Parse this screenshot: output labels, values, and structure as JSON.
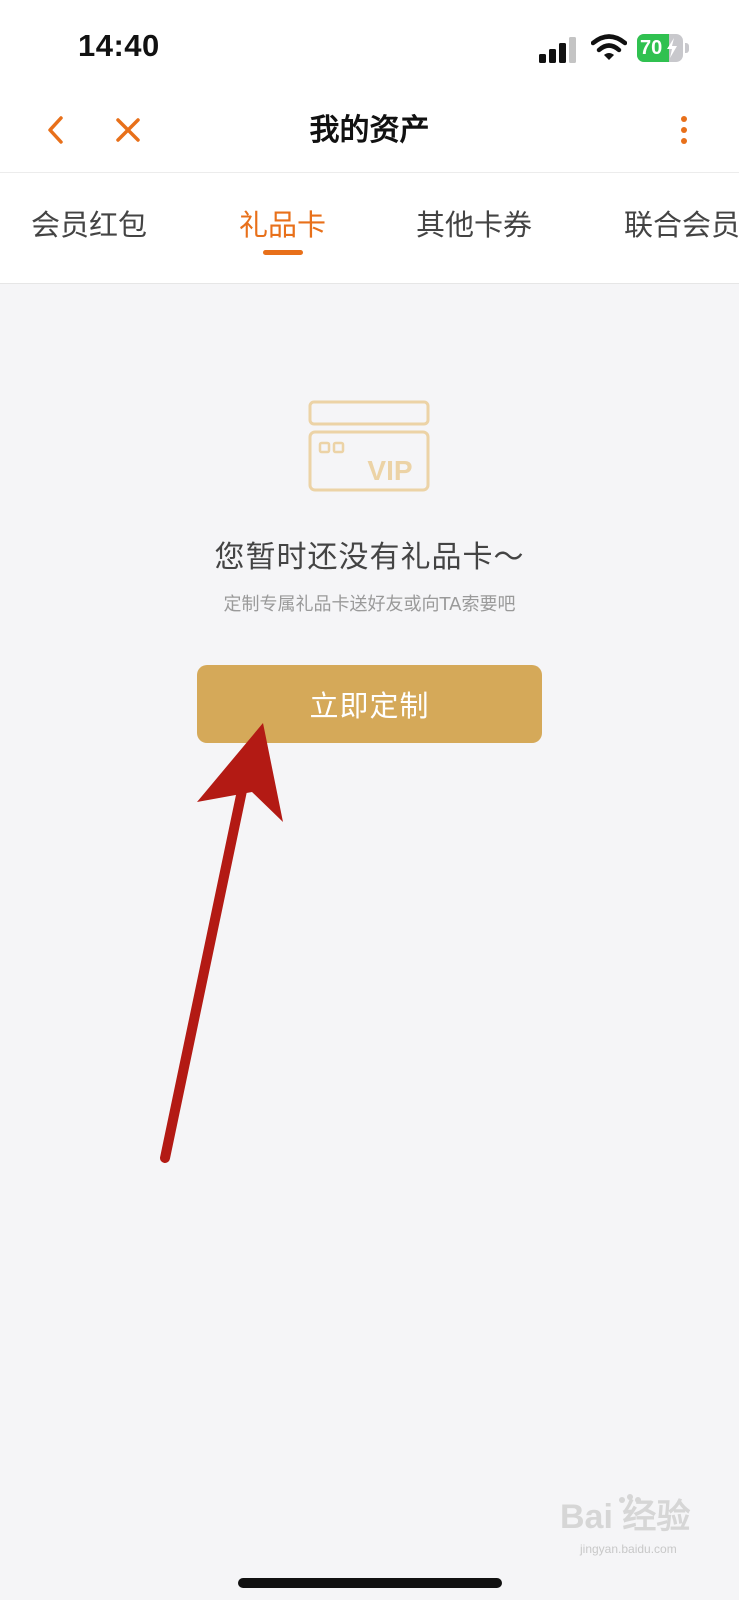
{
  "status_bar": {
    "time": "14:40",
    "battery_level": "70",
    "battery_fraction": 0.7,
    "signal_icon": "signal-bars-icon",
    "wifi_icon": "wifi-icon",
    "charging_icon": "lightning-icon"
  },
  "nav": {
    "title": "我的资产",
    "back_icon": "chevron-left-icon",
    "close_icon": "close-icon",
    "more_icon": "more-vertical-icon",
    "accent_color": "#e8701a"
  },
  "tabs": [
    {
      "label": "会员红包",
      "active": false
    },
    {
      "label": "礼品卡",
      "active": true
    },
    {
      "label": "其他卡券",
      "active": false
    },
    {
      "label": "联合会员",
      "active": false
    }
  ],
  "empty_state": {
    "icon": "vip-card-icon",
    "icon_label": "VIP",
    "title": "您暂时还没有礼品卡～",
    "subtitle": "定制专属礼品卡送好友或向TA索要吧",
    "button_label": "立即定制",
    "button_color": "#d5a959"
  },
  "annotation": {
    "type": "arrow",
    "color": "#b31a14"
  },
  "watermark": {
    "brand": "Bai 经验",
    "url": "jingyan.baidu.com"
  }
}
